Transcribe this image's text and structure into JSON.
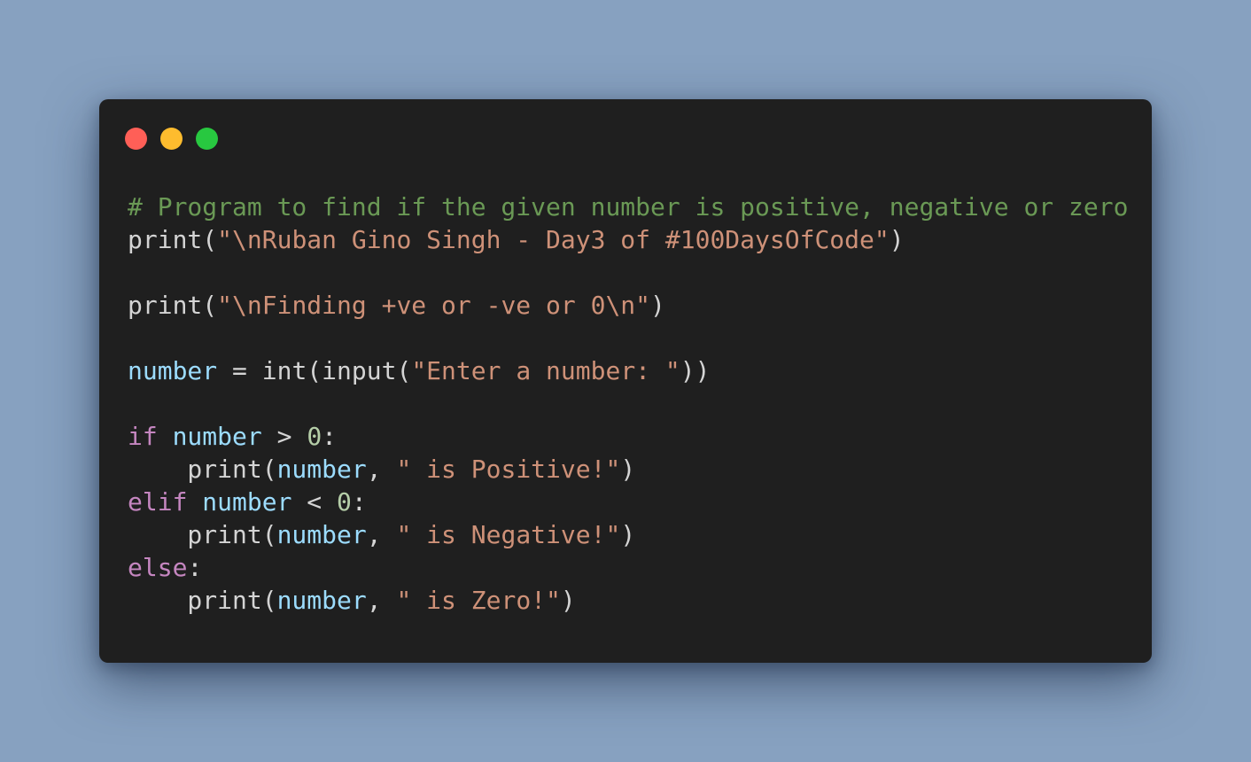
{
  "window": {
    "controls": [
      {
        "name": "close",
        "color": "#ff5f57"
      },
      {
        "name": "minimize",
        "color": "#febc2e"
      },
      {
        "name": "zoom",
        "color": "#28c840"
      }
    ]
  },
  "colors": {
    "background": "#87a1c0",
    "editor_bg": "#1f1f1f",
    "comment": "#6a9955",
    "string": "#ce9178",
    "variable": "#9cdcfe",
    "keyword": "#c586c0",
    "number": "#b5cea8",
    "default": "#d4d4d4"
  },
  "code": {
    "lines": [
      [
        {
          "t": "# Program to find if the given number is positive, negative or zero",
          "c": "comment"
        }
      ],
      [
        {
          "t": "print(",
          "c": "default"
        },
        {
          "t": "\"\\nRuban Gino Singh - Day3 of #100DaysOfCode\"",
          "c": "string"
        },
        {
          "t": ")",
          "c": "default"
        }
      ],
      [],
      [
        {
          "t": "print(",
          "c": "default"
        },
        {
          "t": "\"\\nFinding +ve or -ve or 0\\n\"",
          "c": "string"
        },
        {
          "t": ")",
          "c": "default"
        }
      ],
      [],
      [
        {
          "t": "number",
          "c": "variable"
        },
        {
          "t": " = int(input(",
          "c": "default"
        },
        {
          "t": "\"Enter a number: \"",
          "c": "string"
        },
        {
          "t": "))",
          "c": "default"
        }
      ],
      [],
      [
        {
          "t": "if",
          "c": "keyword"
        },
        {
          "t": " ",
          "c": "default"
        },
        {
          "t": "number",
          "c": "variable"
        },
        {
          "t": " > ",
          "c": "default"
        },
        {
          "t": "0",
          "c": "number"
        },
        {
          "t": ":",
          "c": "default"
        }
      ],
      [
        {
          "t": "    print(",
          "c": "default"
        },
        {
          "t": "number",
          "c": "variable"
        },
        {
          "t": ", ",
          "c": "default"
        },
        {
          "t": "\" is Positive!\"",
          "c": "string"
        },
        {
          "t": ")",
          "c": "default"
        }
      ],
      [
        {
          "t": "elif",
          "c": "keyword"
        },
        {
          "t": " ",
          "c": "default"
        },
        {
          "t": "number",
          "c": "variable"
        },
        {
          "t": " < ",
          "c": "default"
        },
        {
          "t": "0",
          "c": "number"
        },
        {
          "t": ":",
          "c": "default"
        }
      ],
      [
        {
          "t": "    print(",
          "c": "default"
        },
        {
          "t": "number",
          "c": "variable"
        },
        {
          "t": ", ",
          "c": "default"
        },
        {
          "t": "\" is Negative!\"",
          "c": "string"
        },
        {
          "t": ")",
          "c": "default"
        }
      ],
      [
        {
          "t": "else",
          "c": "keyword"
        },
        {
          "t": ":",
          "c": "default"
        }
      ],
      [
        {
          "t": "    print(",
          "c": "default"
        },
        {
          "t": "number",
          "c": "variable"
        },
        {
          "t": ", ",
          "c": "default"
        },
        {
          "t": "\" is Zero!\"",
          "c": "string"
        },
        {
          "t": ")",
          "c": "default"
        }
      ]
    ]
  }
}
